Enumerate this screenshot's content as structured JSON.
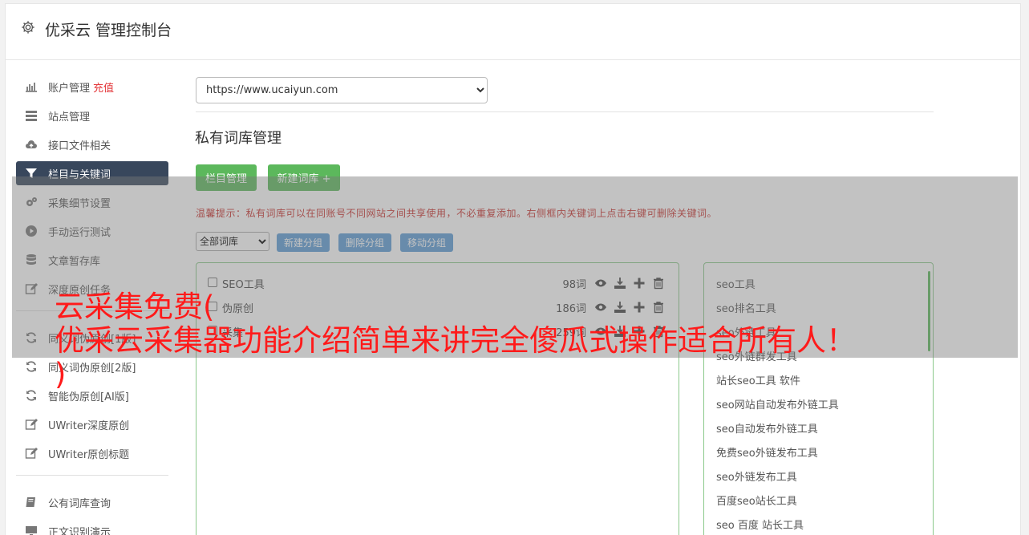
{
  "header": {
    "title": "优采云 管理控制台",
    "icon": "gear-icon"
  },
  "sidebar": {
    "items": [
      {
        "label": "账户管理",
        "badge": "充值",
        "icon": "bar-chart-icon"
      },
      {
        "label": "站点管理",
        "icon": "server-icon"
      },
      {
        "label": "接口文件相关",
        "icon": "cloud-upload-icon"
      },
      {
        "label": "栏目与关键词",
        "icon": "filter-icon",
        "active": true
      },
      {
        "label": "采集细节设置",
        "icon": "gears-icon"
      },
      {
        "label": "手动运行测试",
        "icon": "play-circle-icon"
      },
      {
        "label": "文章暂存库",
        "icon": "database-icon"
      },
      {
        "label": "深度原创任务",
        "icon": "edit-icon"
      }
    ],
    "items2": [
      {
        "label": "同义词伪原创[1版]",
        "icon": "refresh-icon"
      },
      {
        "label": "同义词伪原创[2版]",
        "icon": "refresh-icon"
      },
      {
        "label": "智能伪原创[AI版]",
        "icon": "refresh-icon"
      },
      {
        "label": "UWriter深度原创",
        "icon": "edit-icon"
      },
      {
        "label": "UWriter原创标题",
        "icon": "edit-icon"
      }
    ],
    "items3": [
      {
        "label": "公有词库查询",
        "icon": "book-icon"
      },
      {
        "label": "正文识别演示",
        "icon": "monitor-icon"
      }
    ]
  },
  "main": {
    "site_select": "https://www.ucaiyun.com",
    "section_title": "私有词库管理",
    "btn_columns": "栏目管理",
    "btn_new_lib": "新建词库 +",
    "tip": "温馨提示：私有词库可以在同账号不同网站之间共享使用，不必重复添加。右侧框内关键词上点击右键可删除关键词。",
    "group_select": "全部词库",
    "btn_new_group": "新建分组",
    "btn_delete_group": "删除分组",
    "btn_move_group": "移动分组",
    "libraries": [
      {
        "name": "SEO工具",
        "count": "98词"
      },
      {
        "name": "伪原创",
        "count": "186词"
      },
      {
        "name": "采集",
        "count": "259词"
      }
    ],
    "keywords": [
      "seo工具",
      "seo排名工具",
      "seo外链工具",
      "seo外链群发工具",
      "站长seo工具 软件",
      "seo网站自动发布外链工具",
      "seo自动发布外链工具",
      "免费seo外链发布工具",
      "seo外链发布工具",
      "百度seo站长工具",
      "seo 百度 站长工具"
    ]
  },
  "overlay": {
    "line1": "云采集免费(",
    "line2": "优采云采集器功能介绍简单来讲完全傻瓜式操作适合所有人！",
    "line3": ")"
  },
  "colors": {
    "active_nav": "#38475c",
    "green": "#5cb85c",
    "blue": "#5b9bd5",
    "warning": "#c9302c",
    "overlay_text": "#ff1a1a"
  }
}
